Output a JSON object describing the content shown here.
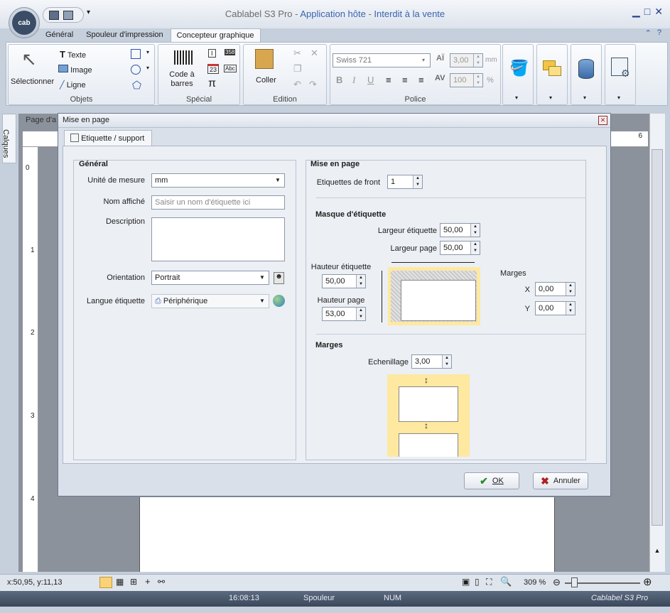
{
  "window": {
    "title": "Cablabel S3 Pro",
    "title_sep": " - ",
    "subtitle": "Application hôte",
    "restriction": "Interdit à la vente"
  },
  "tabs": [
    "Général",
    "Spouleur d'impression",
    "Concepteur graphique"
  ],
  "ribbon": {
    "select_label": "Sélectionner",
    "objets": {
      "texte": "Texte",
      "image": "Image",
      "ligne": "Ligne",
      "label": "Objets"
    },
    "special": {
      "barcode": "Code à barres",
      "pi": "π",
      "label": "Spécial",
      "counter": "358",
      "date": "23",
      "abc": "Abc"
    },
    "edition": {
      "paste": "Coller",
      "label": "Edition"
    },
    "police": {
      "font": "Swiss 721",
      "size": "3,00",
      "unit": "mm",
      "scale": "100",
      "percent": "%",
      "bold": "B",
      "italic": "I",
      "underline": "U",
      "av": "AV",
      "ai": "AÏ",
      "label": "Police"
    }
  },
  "canvas": {
    "page_label": "Page d'a",
    "calques": "Calques",
    "ruler_left": [
      "0",
      "1",
      "2",
      "3",
      "4"
    ],
    "ruler_top_right": "6"
  },
  "dialog": {
    "title": "Mise en page",
    "tab": "Etiquette / support",
    "general": {
      "heading": "Général",
      "unit_label": "Unité de mesure",
      "unit_value": "mm",
      "name_label": "Nom affiché",
      "name_placeholder": "Saisir un nom d'étiquette ici",
      "desc_label": "Description",
      "orientation_label": "Orientation",
      "orientation_value": "Portrait",
      "lang_label": "Langue étiquette",
      "lang_value": "Périphérique"
    },
    "layout": {
      "heading": "Mise en page",
      "front_label": "Etiquettes de front",
      "front_value": "1",
      "mask_heading": "Masque d'étiquette",
      "label_width_label": "Largeur étiquette",
      "label_width": "50,00",
      "page_width_label": "Largeur page",
      "page_width": "50,00",
      "label_height_label": "Hauteur étiquette",
      "label_height": "50,00",
      "page_height_label": "Hauteur page",
      "page_height": "53,00",
      "margins_label": "Marges",
      "x_label": "X",
      "x_value": "0,00",
      "y_label": "Y",
      "y_value": "0,00",
      "margins_heading": "Marges",
      "step_label": "Echenillage",
      "step_value": "3,00"
    },
    "ok": "OK",
    "cancel": "Annuler"
  },
  "status": {
    "coords": "x:50,95, y:11,13",
    "zoom": "309 %",
    "time": "16:08:13",
    "spooler": "Spouleur",
    "num": "NUM",
    "brand": "Cablabel S3 Pro"
  },
  "colors": {
    "accent": "#3a64b0",
    "preview_bg": "#ffe8a0",
    "ok_check": "#2a8a2a",
    "cancel_x": "#b02020"
  }
}
